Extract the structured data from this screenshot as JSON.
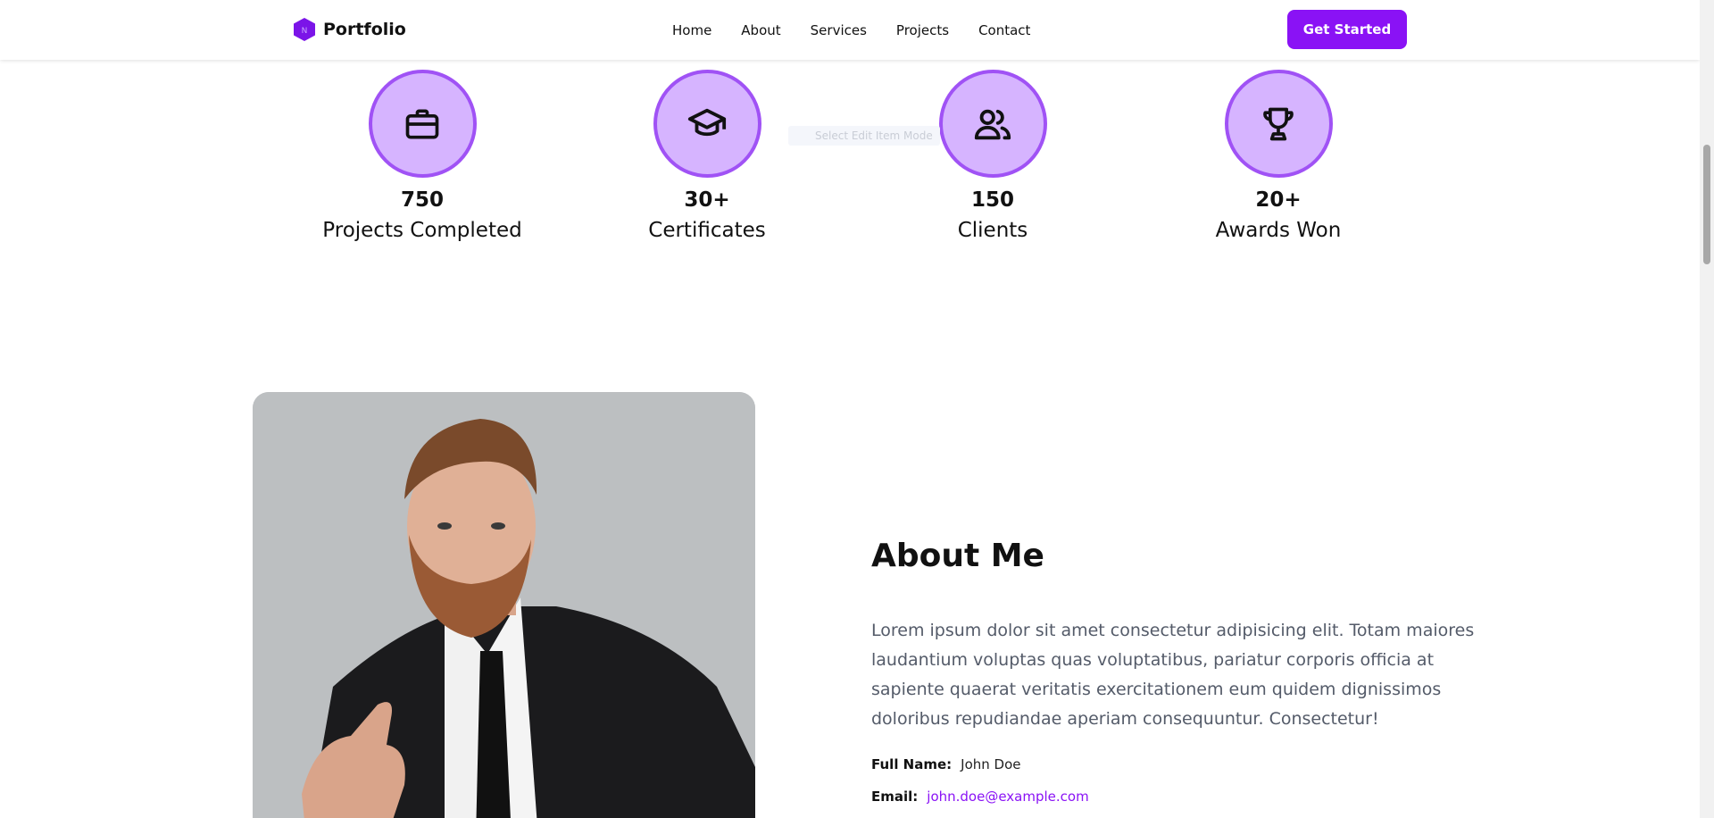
{
  "header": {
    "brand": "Portfolio",
    "nav": [
      "Home",
      "About",
      "Services",
      "Projects",
      "Contact"
    ],
    "cta_label": "Get Started"
  },
  "stats": [
    {
      "icon": "briefcase-icon",
      "number": "750",
      "label": "Projects Completed"
    },
    {
      "icon": "graduation-cap-icon",
      "number": "30+",
      "label": "Certificates"
    },
    {
      "icon": "users-icon",
      "number": "150",
      "label": "Clients"
    },
    {
      "icon": "trophy-icon",
      "number": "20+",
      "label": "Awards Won"
    }
  ],
  "ghost_text": "Select Edit Item Mode",
  "about": {
    "title": "About Me",
    "text": "Lorem ipsum dolor sit amet consectetur adipisicing elit. Totam maiores laudantium voluptas quas voluptatibus, pariatur corporis officia at sapiente quaerat veritatis exercitationem eum quidem dignissimos doloribus repudiandae aperiam consequuntur. Consectetur!",
    "full_name_label": "Full Name:",
    "full_name": "John Doe",
    "email_label": "Email:",
    "email": "john.doe@example.com"
  },
  "colors": {
    "accent": "#8a12f5",
    "circle_fill": "#d6b4ff",
    "circle_border": "#a052f5",
    "photo_bg": "#bcbfc1"
  }
}
